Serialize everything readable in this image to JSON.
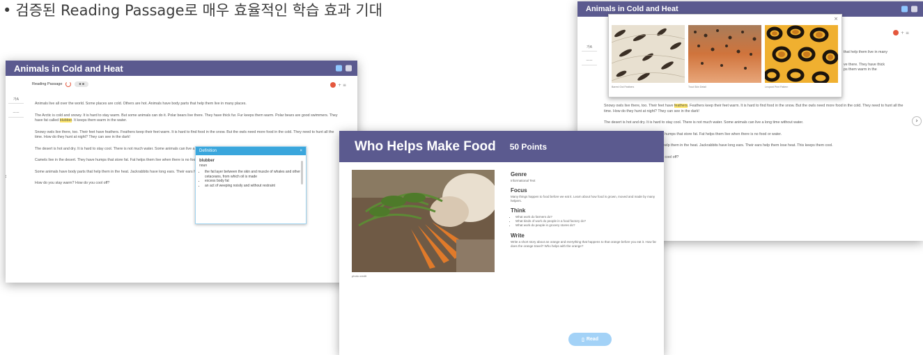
{
  "headline": {
    "bullet": "•",
    "text": "검증된 Reading Passage로 매우 효율적인 학습 효과 기대"
  },
  "left_screen": {
    "title": "Animals in Cold and Heat",
    "toolbar_label": "Reading Passage",
    "toolbar_pills": [
      "■",
      "■"
    ],
    "zoom_label": "+ ≡",
    "side_tabs": [
      "가A",
      "ㅡㅡ"
    ],
    "paragraphs": [
      "Animals live all over the world. Some places are cold. Others are hot. Animals have body parts that help them live in many places.",
      "The Arctic is cold and snowy. It is hard to stay warm. But some animals can do it. Polar bears live there. They have thick fur. Fur keeps them warm. Polar bears are good swimmers. They have fat called",
      "Snowy owls live there, too. Their feet have feathers. Feathers keep their feet warm. It is hard to find food in the snow. But the owls need more food in the cold. They need to hunt all the time. How do they hunt at night? They can see in the dark!",
      "The desert is hot and dry. It is hard to stay cool. There is not much water. Some animals can live a long time without water.",
      "Camels live in the desert. They have humps that store fat. Fat helps them live when there is no food or water.",
      "Some animals have body parts that help them in the heat. Jackrabbits have long ears. Their ears help them lose heat. This keeps them cool.",
      "How do you stay warm? How do you cool off?"
    ],
    "highlight_word": "blubber",
    "p2_after": ". It keeps them warm in the water.",
    "definition": {
      "title": "Definition",
      "word": "blubber",
      "pos": "noun",
      "items": [
        "the fat layer between the skin and muscle of whales and other cetaceans, from which oil is made",
        "excess body fat",
        "an act of weeping noisily and without restraint"
      ],
      "close": "×"
    },
    "arrow_left": "‹",
    "arrow_right": "›"
  },
  "middle_screen": {
    "title": "Who Helps Make Food",
    "points": "50 Points",
    "genre_heading": "Genre",
    "genre_value": "Informational Text",
    "focus_heading": "Focus",
    "focus_text": "Many things happen to food before we eat it. Learn about how food is grown, moved and made by many helpers.",
    "think_heading": "Think",
    "think_items": [
      "What work do farmers do?",
      "What kinds of work do people in a food factory do?",
      "What work do people in grocery stores do?"
    ],
    "write_heading": "Write",
    "write_text": "Write a short story about an orange and everything that happens to that orange before you eat it. How far does the orange travel? Who helps with the orange?",
    "photo_caption": "photo credit",
    "read_button": "Read"
  },
  "right_screen": {
    "title": "Animals in Cold and Heat",
    "zoom_label": "+ ≡",
    "side_tabs": [
      "가A",
      "ㅡㅡ"
    ],
    "partial_lines": [
      "that help them live in many",
      "",
      "ve there. They have thick",
      "ps them warm in the"
    ],
    "paragraphs_pre": "Snowy owls live there, too. Their feet have",
    "highlight_word": "feathers",
    "paragraphs_post": ". Feathers keep their feet warm. It is hard to find food in the snow. But the owls need more food in the cold. They need to hunt all the time. How do they hunt at night? They can see in the dark!",
    "paragraphs": [
      "The desert is hot and dry. It is hard to stay cool. There is not much water. Some animals can live a long time without water.",
      "Camels live in the desert. They have humps that store fat. Fat helps them live when there is no food or water.",
      "Some animals have body parts that help them in the heat. Jackrabbits have long ears. Their ears help them lose heat. This keeps them cool.",
      "How do you stay warm? How do you cool off?"
    ],
    "image_popup": {
      "close": "×",
      "captions": [
        "Barred Owl Feathers",
        "Trout Skin Detail",
        "Leopard Print Pattern"
      ]
    },
    "arrow_right": "›"
  },
  "colors": {
    "titlebar": "#5b5a8f",
    "accent_red": "#e4573d",
    "highlight": "#ffe76a",
    "definition_header": "#3aa6dc",
    "read_button": "#a3d2f7"
  }
}
